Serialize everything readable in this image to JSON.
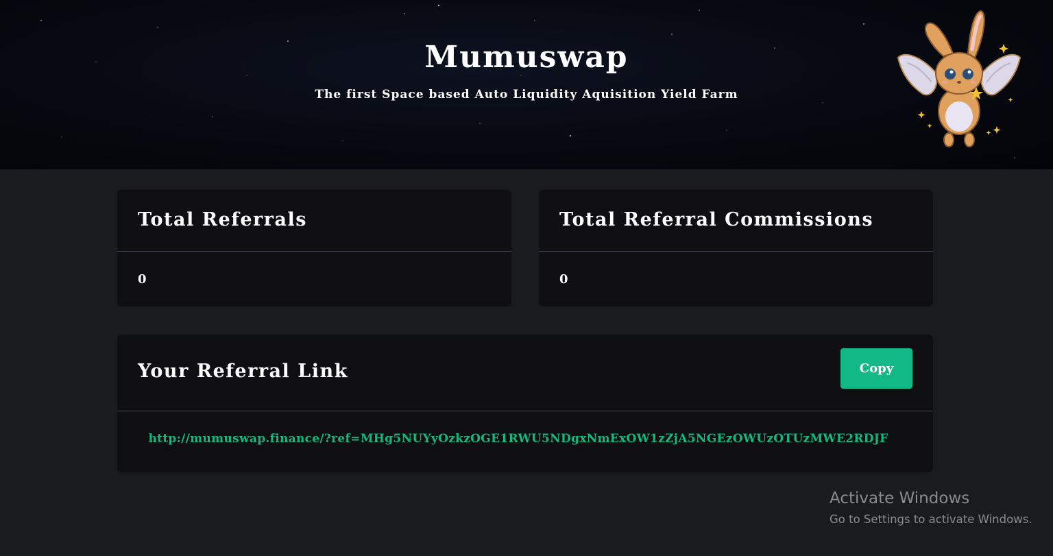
{
  "hero": {
    "title": "Mumuswap",
    "subtitle": "The first Space based Auto Liquidity Aquisition Yield Farm",
    "mascot_icon": "winged-bunny-mascot"
  },
  "stats": {
    "total_referrals": {
      "label": "Total Referrals",
      "value": "0"
    },
    "total_commissions": {
      "label": "Total Referral Commissions",
      "value": "0"
    }
  },
  "referral": {
    "title": "Your Referral Link",
    "copy_label": "Copy",
    "link": "http://mumuswap.finance/?ref=MHg5NUYyOzkzOGE1RWU5NDgxNmExOW1zZjA5NGEzOWUzOTUzMWE2RDJF"
  },
  "watermark": {
    "title": "Activate Windows",
    "subtitle": "Go to Settings to activate Windows."
  },
  "colors": {
    "accent": "#12b886",
    "card_bg": "#0f0f11",
    "page_bg": "#1a1b1f",
    "divider": "#4a4b57"
  }
}
